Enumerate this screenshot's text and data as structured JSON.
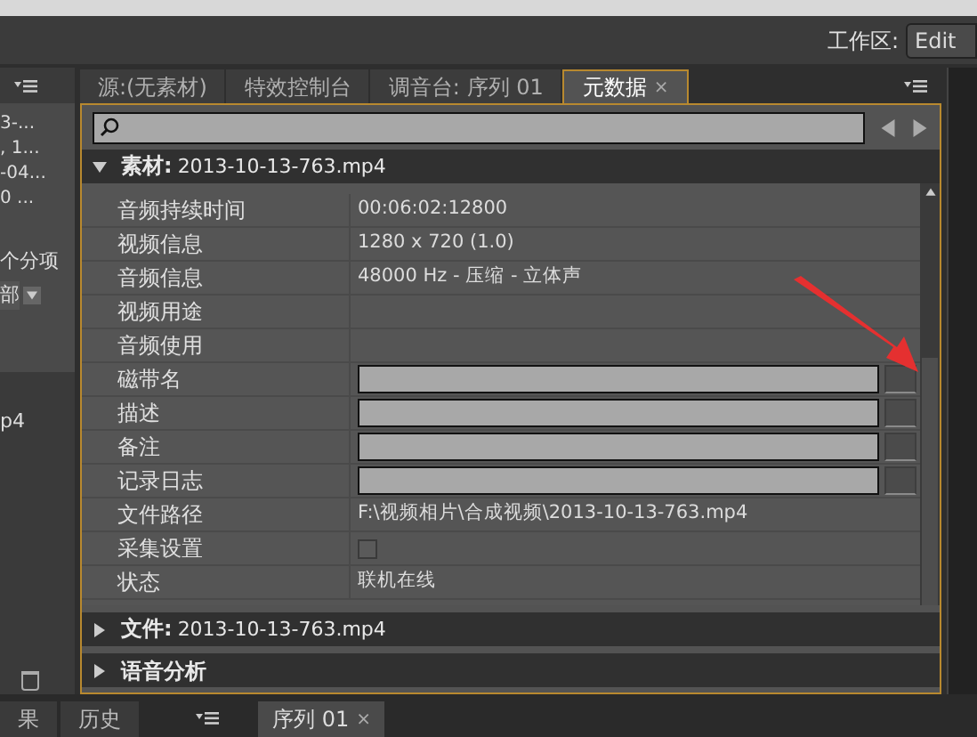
{
  "workspace": {
    "label": "工作区:",
    "value": "Edit"
  },
  "left_panel": {
    "lines": [
      "3-...",
      ", 1...",
      "-04...",
      "0 ..."
    ],
    "count_label": "个分项",
    "dropdown": "部",
    "item": "p4"
  },
  "tabs": [
    {
      "label": "源:(无素材)",
      "selected": false
    },
    {
      "label": "特效控制台",
      "selected": false
    },
    {
      "label": "调音台: 序列 01",
      "selected": false
    },
    {
      "label": "元数据",
      "selected": true,
      "close": "×"
    }
  ],
  "sections": [
    {
      "title": "素材:",
      "name": "2013-10-13-763.mp4",
      "expanded": true,
      "rows": [
        {
          "kind": "text",
          "label": "音频持续时间",
          "value": "00:06:02:12800"
        },
        {
          "kind": "text",
          "label": "视频信息",
          "value": "1280 x 720 (1.0)"
        },
        {
          "kind": "text",
          "label": "音频信息",
          "value": "48000 Hz - 压缩 - 立体声"
        },
        {
          "kind": "text",
          "label": "视频用途"
        },
        {
          "kind": "text",
          "label": "音频使用"
        },
        {
          "kind": "field",
          "label": "磁带名"
        },
        {
          "kind": "field",
          "label": "描述"
        },
        {
          "kind": "field",
          "label": "备注"
        },
        {
          "kind": "field",
          "label": "记录日志"
        },
        {
          "kind": "text",
          "label": "文件路径",
          "value": "F:\\视频相片\\合成视频\\2013-10-13-763.mp4"
        },
        {
          "kind": "checkbox",
          "label": "采集设置",
          "checked": false
        },
        {
          "kind": "text",
          "label": "状态",
          "value": "联机在线"
        }
      ]
    },
    {
      "title": "文件:",
      "name": "2013-10-13-763.mp4",
      "expanded": false
    },
    {
      "title": "语音分析",
      "expanded": false
    }
  ],
  "bottom_tabs": [
    {
      "label": "果",
      "selected": false
    },
    {
      "label": "历史",
      "selected": false
    }
  ],
  "sequence_tab": {
    "label": "序列 01",
    "close": "×"
  }
}
